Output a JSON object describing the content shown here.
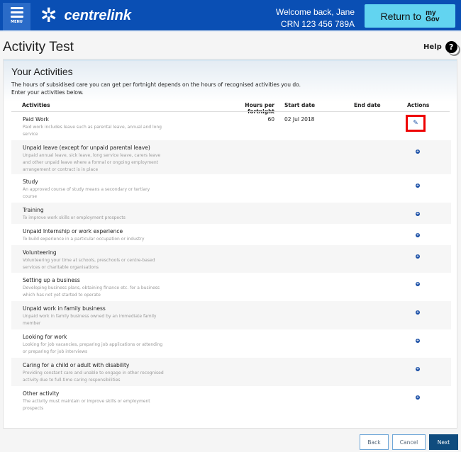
{
  "header": {
    "menu_label": "MENU",
    "brand": "centrelink",
    "welcome": "Welcome back, Jane",
    "crn": "CRN 123 456 789A",
    "return_label": "Return to",
    "mygov_top": "my",
    "mygov_bottom": "Gov"
  },
  "page": {
    "title": "Activity Test",
    "help": "Help"
  },
  "panel": {
    "title": "Your Activities",
    "intro1": "The hours of subsidised care you can get per fortnight depends on the hours of recognised activities you do.",
    "intro2": "Enter your activities below."
  },
  "columns": {
    "activities": "Activities",
    "hours": "Hours per fortnight",
    "start": "Start date",
    "end": "End date",
    "actions": "Actions"
  },
  "activities": [
    {
      "name": "Paid Work",
      "desc": "Paid work includes leave such as parental leave, annual and long service",
      "hours": "60",
      "start": "02 Jul 2018",
      "end": "",
      "action": "edit-icon"
    },
    {
      "name": "Unpaid leave (except for unpaid parental leave)",
      "desc": "Unpaid annual leave, sick leave, long service leave, carers leave and other unpaid leave where a formal or ongoing employment arrangement or contract is in place",
      "action": "add-icon"
    },
    {
      "name": "Study",
      "desc": "An approved course of study means a secondary or tertiary course",
      "action": "add-icon"
    },
    {
      "name": "Training",
      "desc": "To improve work skills or employment prospects",
      "action": "add-icon"
    },
    {
      "name": "Unpaid Internship or work experience",
      "desc": "To build experience in a particular occupation or industry",
      "action": "add-icon"
    },
    {
      "name": "Volunteering",
      "desc": "Volunteering your time at schools, preschools or centre-based services or charitable organisations",
      "action": "add-icon"
    },
    {
      "name": "Setting up a business",
      "desc": "Developing business plans, obtaining finance etc. for a business which has not yet started to operate",
      "action": "add-icon"
    },
    {
      "name": "Unpaid work in family business",
      "desc": "Unpaid work in family business owned by an immediate family member",
      "action": "add-icon"
    },
    {
      "name": "Looking for work",
      "desc": "Looking for job vacancies, preparing job applications or attending or preparing for job interviews",
      "action": "add-icon"
    },
    {
      "name": "Caring for a child or adult with disability",
      "desc": "Providing constant care and unable to engage in other recognised activity due to full-time caring responsibilities",
      "action": "add-icon"
    },
    {
      "name": "Other activity",
      "desc": "The activity must maintain or improve skills or employment prospects",
      "action": "add-icon"
    }
  ],
  "footer": {
    "back": "Back",
    "cancel": "Cancel",
    "next": "Next"
  },
  "colors": {
    "header": "#0a4fb4",
    "mygov": "#62d4f0",
    "next": "#0f4c7e",
    "highlight": "#e00000"
  }
}
